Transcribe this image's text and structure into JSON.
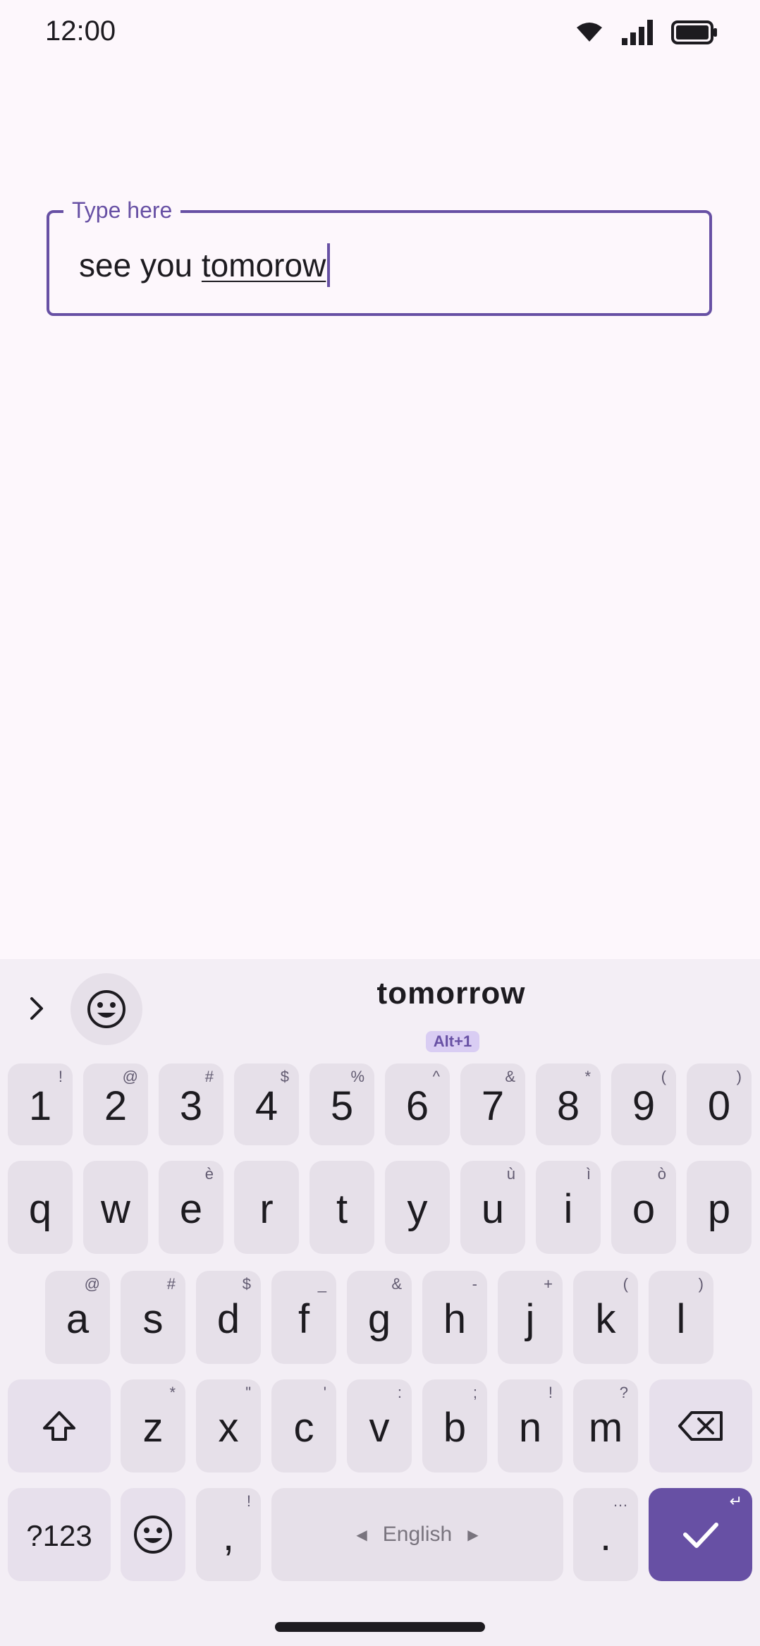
{
  "status_bar": {
    "time": "12:00",
    "icons": [
      "wifi-icon",
      "signal-icon",
      "battery-icon"
    ]
  },
  "text_field": {
    "label": "Type here",
    "value_prefix": "see you ",
    "value_composing": "tomorow"
  },
  "keyboard": {
    "suggestion": "tomorrow",
    "suggestion_shortcut": "Alt+1",
    "rows": {
      "numbers": [
        {
          "main": "1",
          "hint": "!"
        },
        {
          "main": "2",
          "hint": "@"
        },
        {
          "main": "3",
          "hint": "#"
        },
        {
          "main": "4",
          "hint": "$"
        },
        {
          "main": "5",
          "hint": "%"
        },
        {
          "main": "6",
          "hint": "^"
        },
        {
          "main": "7",
          "hint": "&"
        },
        {
          "main": "8",
          "hint": "*"
        },
        {
          "main": "9",
          "hint": "("
        },
        {
          "main": "0",
          "hint": ")"
        }
      ],
      "row1": [
        {
          "main": "q",
          "hint": ""
        },
        {
          "main": "w",
          "hint": ""
        },
        {
          "main": "e",
          "hint": "è"
        },
        {
          "main": "r",
          "hint": ""
        },
        {
          "main": "t",
          "hint": ""
        },
        {
          "main": "y",
          "hint": ""
        },
        {
          "main": "u",
          "hint": "ù"
        },
        {
          "main": "i",
          "hint": "ì"
        },
        {
          "main": "o",
          "hint": "ò"
        },
        {
          "main": "p",
          "hint": ""
        }
      ],
      "row2": [
        {
          "main": "a",
          "hint": "@"
        },
        {
          "main": "s",
          "hint": "#"
        },
        {
          "main": "d",
          "hint": "$"
        },
        {
          "main": "f",
          "hint": "_"
        },
        {
          "main": "g",
          "hint": "&"
        },
        {
          "main": "h",
          "hint": "-"
        },
        {
          "main": "j",
          "hint": "+"
        },
        {
          "main": "k",
          "hint": "("
        },
        {
          "main": "l",
          "hint": ")"
        }
      ],
      "row3": [
        {
          "main": "z",
          "hint": "*"
        },
        {
          "main": "x",
          "hint": "\""
        },
        {
          "main": "c",
          "hint": "'"
        },
        {
          "main": "v",
          "hint": ":"
        },
        {
          "main": "b",
          "hint": ";"
        },
        {
          "main": "n",
          "hint": "!"
        },
        {
          "main": "m",
          "hint": "?"
        }
      ]
    },
    "symbols_key": "?123",
    "comma_key": {
      "main": ",",
      "hint": "!"
    },
    "space_label": "English",
    "period_key": {
      "main": ".",
      "hint": "…"
    },
    "enter_hint": "↵",
    "accent_color": "#6750a4",
    "key_color": "#e6e0e9",
    "background_color": "#f3eef5"
  }
}
